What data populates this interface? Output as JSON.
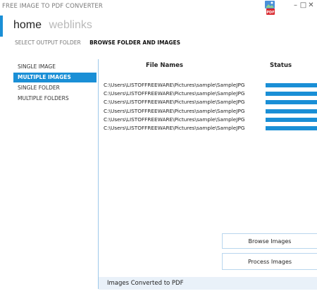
{
  "window": {
    "title": "FREE IMAGE TO PDF CONVERTER",
    "logo_label": "PDF",
    "controls": [
      "–",
      "□",
      "✕"
    ]
  },
  "nav": {
    "home": "home",
    "weblinks": "weblinks"
  },
  "subnav": {
    "select_output": "SELECT OUTPUT FOLDER",
    "browse": "BROWSE FOLDER AND IMAGES"
  },
  "sidebar": {
    "items": [
      {
        "label": "SINGLE IMAGE",
        "selected": false
      },
      {
        "label": "MULTIPLE IMAGES",
        "selected": true
      },
      {
        "label": "SINGLE FOLDER",
        "selected": false
      },
      {
        "label": "MULTIPLE FOLDERS",
        "selected": false
      }
    ]
  },
  "table": {
    "headers": {
      "file_names": "File Names",
      "status": "Status"
    },
    "rows": [
      {
        "path": "C:\\Users\\LISTOFFREEWARE\\Pictures\\sample\\SampleJPG",
        "progress": 1.0
      },
      {
        "path": "C:\\Users\\LISTOFFREEWARE\\Pictures\\sample\\SampleJPG",
        "progress": 1.0
      },
      {
        "path": "C:\\Users\\LISTOFFREEWARE\\Pictures\\sample\\SampleJPG",
        "progress": 1.0
      },
      {
        "path": "C:\\Users\\LISTOFFREEWARE\\Pictures\\sample\\SampleJPG",
        "progress": 1.0
      },
      {
        "path": "C:\\Users\\LISTOFFREEWARE\\Pictures\\sample\\SampleJPG",
        "progress": 1.0
      },
      {
        "path": "C:\\Users\\LISTOFFREEWARE\\Pictures\\sample\\SampleJPG",
        "progress": 1.0
      }
    ]
  },
  "buttons": {
    "browse": "Browse Images",
    "process": "Process Images"
  },
  "status": {
    "message": "Images Converted to PDF"
  },
  "colors": {
    "accent": "#1a8fd6",
    "status_bg": "#e9f1f9"
  },
  "icons": {
    "logo": "pdf-converter-icon"
  }
}
